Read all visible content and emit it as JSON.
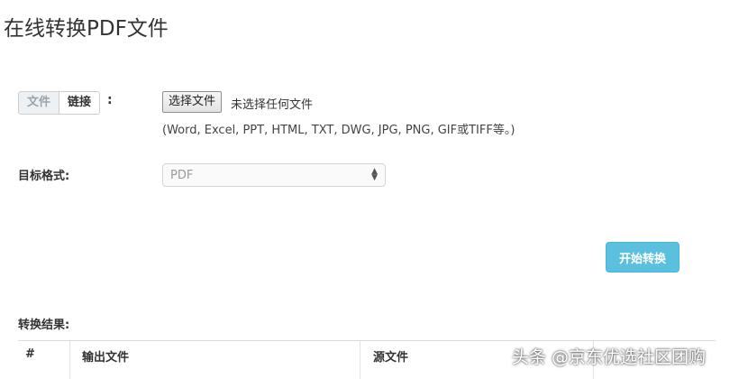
{
  "page": {
    "title": "在线转换PDF文件"
  },
  "source": {
    "tabs": [
      {
        "label": "文件",
        "active": true
      },
      {
        "label": "链接",
        "active": false
      }
    ],
    "colon": ":",
    "file_button_label": "选择文件",
    "file_status": "未选择任何文件",
    "formats_hint": "(Word, Excel, PPT, HTML, TXT, DWG, JPG, PNG, GIF或TIFF等。)"
  },
  "target": {
    "label": "目标格式:",
    "selected": "PDF"
  },
  "actions": {
    "convert_label": "开始转换"
  },
  "results": {
    "label": "转换结果:",
    "columns": [
      "#",
      "输出文件",
      "源文件"
    ]
  },
  "watermark": "头条 @京东优选社区团购",
  "colors": {
    "accent": "#5bc0de",
    "text": "#333333"
  }
}
